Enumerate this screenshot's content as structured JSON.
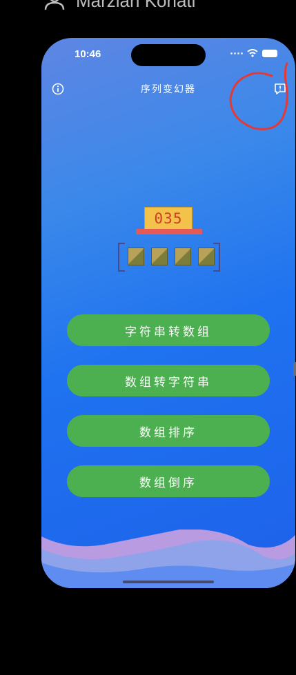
{
  "caption": {
    "text": "Marzlan Kohati",
    "icon": "person-icon"
  },
  "status_bar": {
    "time": "10:46",
    "icons": [
      "signal-icon",
      "wifi-icon",
      "battery-icon"
    ]
  },
  "nav": {
    "title": "序列变幻器",
    "left_icon": "info-icon",
    "right_icon": "feedback-icon"
  },
  "illustration": {
    "counter": "035",
    "tile_count": 4,
    "colors": {
      "counter_bg": "#f2c24a",
      "counter_text": "#d03c2a",
      "shelf": "#e45a55"
    }
  },
  "buttons": [
    {
      "label": "字符串转数组"
    },
    {
      "label": "数组转字符串"
    },
    {
      "label": "数组排序"
    },
    {
      "label": "数组倒序"
    }
  ],
  "colors": {
    "button_bg": "#4caf50",
    "background_top": "#5f86e3",
    "background_bottom": "#1e61ea",
    "annotation": "#e53935"
  }
}
